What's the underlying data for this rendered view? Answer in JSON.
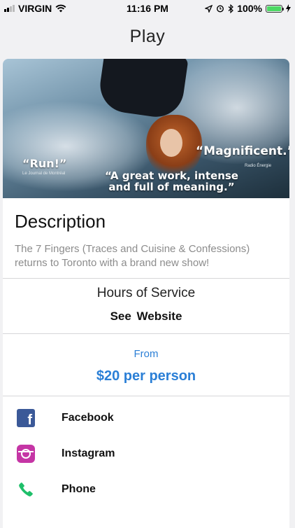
{
  "status_bar": {
    "carrier": "VIRGIN",
    "time": "11:16 PM",
    "battery": "100%"
  },
  "nav": {
    "title": "Play"
  },
  "hero": {
    "quote_1": "“Run!”",
    "source_1": "Le Journal de Montréal",
    "quote_2": "“Magnificent.”",
    "source_2": "Radio Énergie",
    "quote_3_line1": "“A great work, intense",
    "quote_3_line2": "and full of meaning.”"
  },
  "description": {
    "heading": "Description",
    "text": "The 7 Fingers (Traces and Cuisine & Confessions) returns to Toronto with a brand new show!"
  },
  "hours": {
    "title": "Hours of Service",
    "value": "See  Website"
  },
  "price": {
    "from_label": "From",
    "amount": "$20 per person"
  },
  "links": [
    {
      "label": "Facebook",
      "icon": "facebook-icon"
    },
    {
      "label": "Instagram",
      "icon": "instagram-icon"
    },
    {
      "label": "Phone",
      "icon": "phone-icon"
    }
  ],
  "colors": {
    "accent": "#2b7fd6",
    "facebook": "#3b5998",
    "instagram": "#c535a5",
    "phone": "#1fbf6a"
  }
}
